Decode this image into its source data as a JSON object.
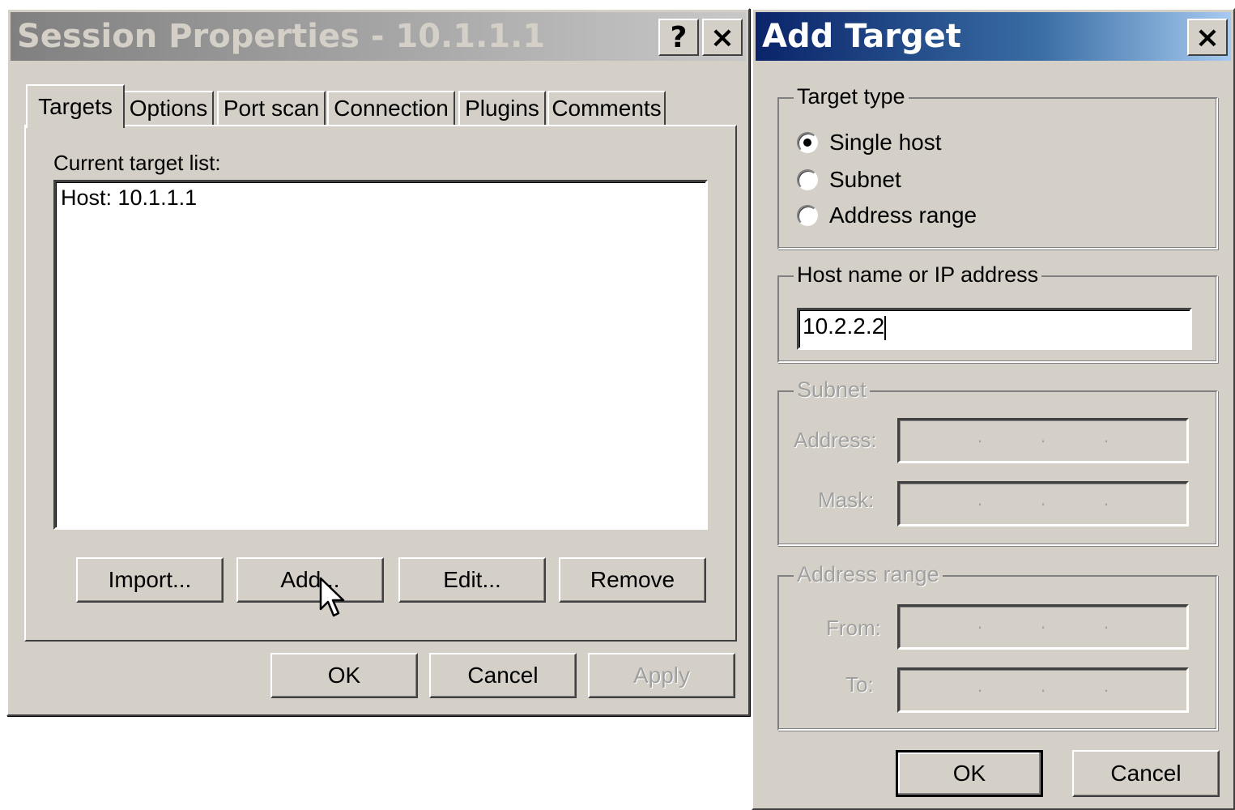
{
  "session_dialog": {
    "title": "Session Properties - 10.1.1.1",
    "help_button": "?",
    "close_button": "×",
    "tabs": [
      "Targets",
      "Options",
      "Port scan",
      "Connection",
      "Plugins",
      "Comments"
    ],
    "target_list_label": "Current target list:",
    "target_list": [
      "Host: 10.1.1.1"
    ],
    "buttons": {
      "import": "Import...",
      "add": "Add...",
      "edit": "Edit...",
      "remove": "Remove",
      "ok": "OK",
      "cancel": "Cancel",
      "apply": "Apply"
    }
  },
  "add_target_dialog": {
    "title": "Add Target",
    "close_button": "×",
    "target_type": {
      "legend": "Target type",
      "options": [
        "Single host",
        "Subnet",
        "Address range"
      ],
      "selected": "Single host"
    },
    "host": {
      "legend": "Host name or IP address",
      "value": "10.2.2.2"
    },
    "subnet": {
      "legend": "Subnet",
      "address_label": "Address:",
      "mask_label": "Mask:"
    },
    "address_range": {
      "legend": "Address range",
      "from_label": "From:",
      "to_label": "To:"
    },
    "buttons": {
      "ok": "OK",
      "cancel": "Cancel"
    }
  },
  "icons": {
    "cursor": "mouse-pointer-icon"
  },
  "colors": {
    "active_title": "#0a246a",
    "inactive_title": "#808080",
    "face": "#d4d0c8"
  }
}
